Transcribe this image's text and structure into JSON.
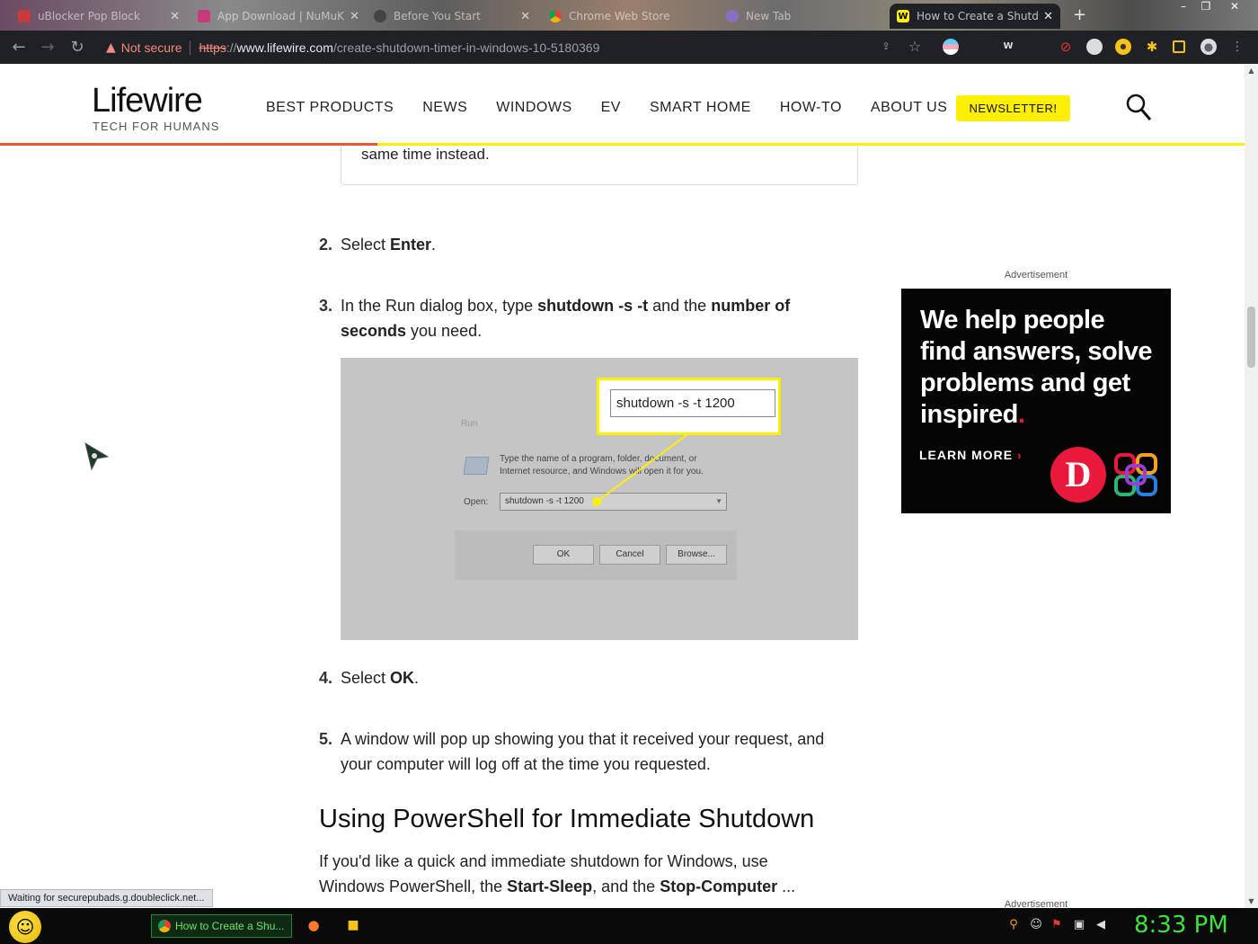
{
  "browser": {
    "tabs": [
      {
        "title": "uBlocker Pop Block",
        "active": false
      },
      {
        "title": "App Download | NuMuKi",
        "active": false
      },
      {
        "title": "Before You Start",
        "active": false
      },
      {
        "title": "Chrome Web Store",
        "active": false
      },
      {
        "title": "New Tab",
        "active": false
      },
      {
        "title": "How to Create a Shutdo",
        "active": true
      }
    ],
    "security_label": "Not secure",
    "url_scheme": "https",
    "url_sep": "://",
    "url_host": "www.lifewire.com",
    "url_path": "/create-shutdown-timer-in-windows-10-5180369"
  },
  "site": {
    "logo": "Lifewire",
    "tagline": "TECH FOR HUMANS",
    "nav": [
      "BEST PRODUCTS",
      "NEWS",
      "WINDOWS",
      "EV",
      "SMART HOME",
      "HOW-TO",
      "ABOUT US"
    ],
    "newsletter_label": "NEWSLETTER!",
    "brand_yellow": "#ffef00",
    "brand_orange": "#e8593a"
  },
  "article": {
    "callout_tail": "same time instead.",
    "steps": [
      {
        "num": "2.",
        "pre": "Select ",
        "bold": "Enter",
        "post": "."
      },
      {
        "num": "3.",
        "pre": "In the Run dialog box, type ",
        "bold": "shutdown -s -t",
        "mid": " and the ",
        "bold2": "number of seconds",
        "post": " you need."
      },
      {
        "num": "4.",
        "pre": "Select ",
        "bold": "OK",
        "post": "."
      },
      {
        "num": "5.",
        "text": "A window will pop up showing you that it received your request, and your computer will log off at the time you requested."
      }
    ],
    "figure": {
      "run_title": "Run",
      "description": "Type the name of a program, folder, document, or Internet resource, and Windows will open it for you.",
      "open_label": "Open:",
      "open_value": "shutdown -s -t 1200",
      "callout_value": "shutdown -s -t 1200",
      "ok": "OK",
      "cancel": "Cancel",
      "browse": "Browse..."
    },
    "heading": "Using PowerShell for Immediate Shutdown",
    "para_pre": "If you'd like a quick and immediate shutdown for Windows, use Windows PowerShell, the ",
    "para_b1": "Start-Sleep",
    "para_mid": ", and the ",
    "para_b2": "Stop-Computer",
    "para_post": " ..."
  },
  "ads": {
    "label": "Advertisement",
    "headline": "We help people find answers, solve problems and get inspired",
    "headline_dot": ".",
    "cta": "LEARN MORE",
    "cta_arrow": "›",
    "badge": "D"
  },
  "status_text": "Waiting for securepubads.g.doubleclick.net...",
  "taskbar": {
    "task_label": "How to Create a Shu...",
    "clock": "8:33 PM"
  }
}
